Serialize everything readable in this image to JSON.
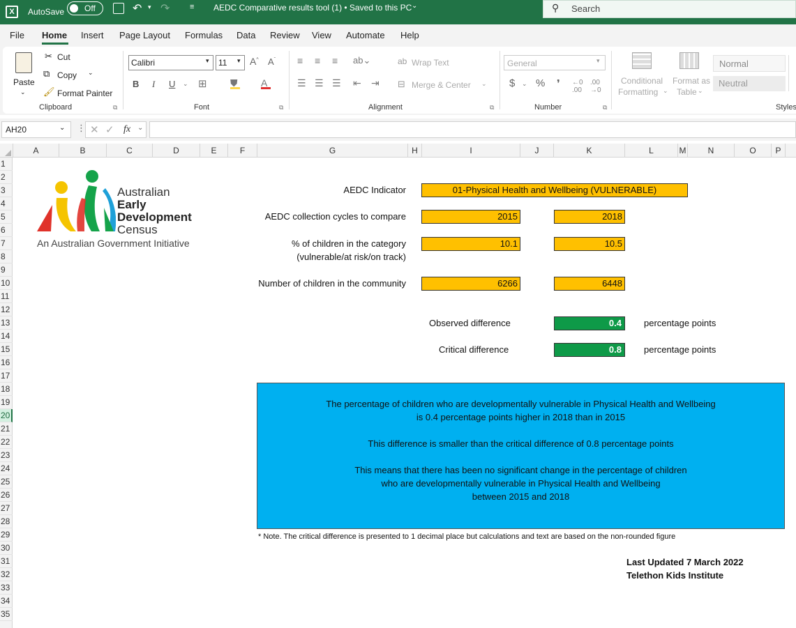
{
  "titlebar": {
    "autosave_label": "AutoSave",
    "autosave_state": "Off",
    "doc_title": "AEDC Comparative results tool (1) • Saved to this PC",
    "search_placeholder": "Search"
  },
  "menu": [
    "File",
    "Home",
    "Insert",
    "Page Layout",
    "Formulas",
    "Data",
    "Review",
    "View",
    "Automate",
    "Help"
  ],
  "ribbon": {
    "clipboard": {
      "paste": "Paste",
      "cut": "Cut",
      "copy": "Copy",
      "format_painter": "Format Painter",
      "label": "Clipboard"
    },
    "font": {
      "name": "Calibri",
      "size": "11",
      "label": "Font"
    },
    "alignment": {
      "wrap": "Wrap Text",
      "merge": "Merge & Center",
      "label": "Alignment"
    },
    "number": {
      "format": "General",
      "label": "Number"
    },
    "styles": {
      "cond1": "Conditional",
      "cond2": "Formatting",
      "fmt1": "Format as",
      "fmt2": "Table",
      "normal": "Normal",
      "neutral": "Neutral",
      "label": "Styles"
    }
  },
  "formula_bar": {
    "name_box": "AH20",
    "fx": "fx",
    "value": ""
  },
  "columns": [
    "A",
    "B",
    "C",
    "D",
    "E",
    "F",
    "G",
    "H",
    "I",
    "J",
    "K",
    "L",
    "M",
    "N",
    "O",
    "P"
  ],
  "rows": [
    "1",
    "2",
    "3",
    "4",
    "5",
    "6",
    "7",
    "8",
    "9",
    "10",
    "11",
    "12",
    "13",
    "14",
    "15",
    "16",
    "17",
    "18",
    "19",
    "20",
    "21",
    "22",
    "23",
    "24",
    "25",
    "26",
    "27",
    "28",
    "29",
    "30",
    "31",
    "32",
    "33",
    "34",
    "35"
  ],
  "selected_row": "20",
  "logo": {
    "line1": "Australian",
    "line2": "Early",
    "line3": "Development",
    "line4": "Census",
    "tagline": "An Australian Government Initiative"
  },
  "sheet": {
    "indicator_label": "AEDC Indicator",
    "indicator_value": "01-Physical Health and Wellbeing (VULNERABLE)",
    "cycles_label": "AEDC collection cycles to compare",
    "cycle1": "2015",
    "cycle2": "2018",
    "pct_label1": "% of children in the category",
    "pct_label2": "(vulnerable/at risk/on track)",
    "pct1": "10.1",
    "pct2": "10.5",
    "num_label": "Number of children in the community",
    "num1": "6266",
    "num2": "6448",
    "obs_label": "Observed difference",
    "obs_value": "0.4",
    "crit_label": "Critical difference",
    "crit_value": "0.8",
    "unit": "percentage points",
    "message": {
      "l1": "The percentage of children who are developmentally vulnerable in Physical Health and Wellbeing",
      "l2": "is 0.4 percentage points higher in 2018 than in 2015",
      "l3": "This difference is smaller than the critical difference of 0.8 percentage points",
      "l4": "This means that there has been no significant change in the percentage of children",
      "l5": "who are developmentally vulnerable in Physical Health and Wellbeing",
      "l6": "between 2015 and 2018"
    },
    "note": "* Note.  The critical difference is presented to 1 decimal place but calculations and text are based on the non-rounded figure",
    "updated": "Last Updated 7 March 2022",
    "institute": "Telethon Kids Institute"
  },
  "colors": {
    "excel_green": "#217346",
    "yellow": "#ffc000",
    "green_cell": "#0e9a48",
    "message_blue": "#00b0f0"
  }
}
